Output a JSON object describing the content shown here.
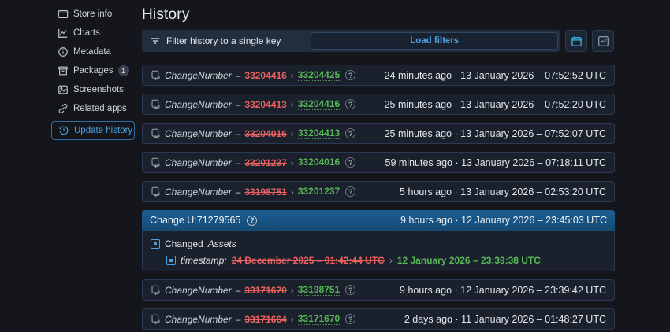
{
  "symbols": {
    "dash": "–",
    "arrow": "›",
    "help": "?"
  },
  "page": {
    "title": "History"
  },
  "sidebar": {
    "items": [
      {
        "label": "Store info"
      },
      {
        "label": "Charts"
      },
      {
        "label": "Metadata"
      },
      {
        "label": "Packages",
        "badge": "1"
      },
      {
        "label": "Screenshots"
      },
      {
        "label": "Related apps"
      },
      {
        "label": "Update history"
      }
    ]
  },
  "filter": {
    "label": "Filter history to a single key",
    "load_button": "Load filters"
  },
  "history": {
    "rows": [
      {
        "key": "ChangeNumber",
        "old": "33204416",
        "new": "33204425",
        "time": "24 minutes ago · 13 January 2026 – 07:52:52 UTC"
      },
      {
        "key": "ChangeNumber",
        "old": "33204413",
        "new": "33204416",
        "time": "25 minutes ago · 13 January 2026 – 07:52:20 UTC"
      },
      {
        "key": "ChangeNumber",
        "old": "33204016",
        "new": "33204413",
        "time": "25 minutes ago · 13 January 2026 – 07:52:07 UTC"
      },
      {
        "key": "ChangeNumber",
        "old": "33201237",
        "new": "33204016",
        "time": "59 minutes ago · 13 January 2026 – 07:18:11 UTC"
      },
      {
        "key": "ChangeNumber",
        "old": "33198751",
        "new": "33201237",
        "time": "5 hours ago · 13 January 2026 – 02:53:20 UTC"
      },
      {
        "key": "ChangeNumber",
        "old": "33171670",
        "new": "33198751",
        "time": "9 hours ago · 12 January 2026 – 23:39:42 UTC"
      },
      {
        "key": "ChangeNumber",
        "old": "33171664",
        "new": "33171670",
        "time": "2 days ago · 11 January 2026 – 01:48:27 UTC"
      }
    ],
    "expanded": {
      "title": "Change U:71279565",
      "time": "9 hours ago · 12 January 2026 – 23:45:03 UTC",
      "changed_label": "Changed",
      "changed_target": "Assets",
      "field": "timestamp:",
      "old": "24 December 2025 – 01:42:44 UTC",
      "new": "12 January 2026 – 23:39:38 UTC"
    }
  },
  "colors": {
    "accent": "#4ba3e3",
    "removed": "#e8615f",
    "added": "#57b857"
  }
}
